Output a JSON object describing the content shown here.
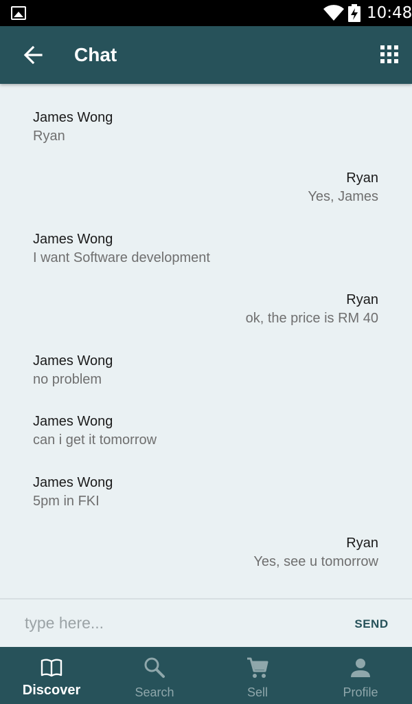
{
  "status_bar": {
    "time": "10:48"
  },
  "app_bar": {
    "title": "Chat"
  },
  "messages": [
    {
      "sender": "James Wong",
      "text": "Ryan",
      "side": "left"
    },
    {
      "sender": "Ryan",
      "text": "Yes, James",
      "side": "right"
    },
    {
      "sender": "James Wong",
      "text": "I want Software development",
      "side": "left"
    },
    {
      "sender": "Ryan",
      "text": "ok, the price is RM 40",
      "side": "right"
    },
    {
      "sender": "James Wong",
      "text": "no problem",
      "side": "left"
    },
    {
      "sender": "James Wong",
      "text": "can i get it tomorrow",
      "side": "left"
    },
    {
      "sender": "James Wong",
      "text": "5pm in FKI",
      "side": "left"
    },
    {
      "sender": "Ryan",
      "text": "Yes, see u tomorrow",
      "side": "right"
    }
  ],
  "composer": {
    "placeholder": "type here...",
    "value": "",
    "send_label": "SEND"
  },
  "bottom_nav": [
    {
      "label": "Discover",
      "icon": "book-icon",
      "active": true
    },
    {
      "label": "Search",
      "icon": "search-icon",
      "active": false
    },
    {
      "label": "Sell",
      "icon": "cart-icon",
      "active": false
    },
    {
      "label": "Profile",
      "icon": "person-icon",
      "active": false
    }
  ],
  "colors": {
    "primary": "#27525a",
    "background": "#eaf1f3",
    "inactive_nav": "#8fa7ab"
  }
}
